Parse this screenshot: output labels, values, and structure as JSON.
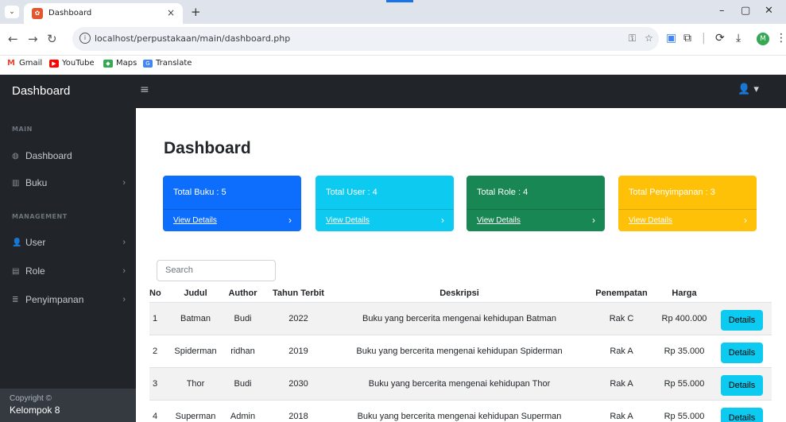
{
  "browser": {
    "tab_title": "Dashboard",
    "tab_close": "×",
    "new_tab": "+",
    "url": "localhost/perpustakaan/main/dashboard.php",
    "bookmarks": [
      "Gmail",
      "YouTube",
      "Maps",
      "Translate"
    ],
    "profile_initial": "M",
    "window_controls": [
      "–",
      "▢",
      "✕"
    ]
  },
  "app": {
    "brand": "Dashboard",
    "hamburger": "≡",
    "user_menu": "👤 ▾"
  },
  "sidebar": {
    "sections": [
      {
        "heading": "MAIN",
        "items": [
          {
            "label": "Dashboard",
            "icon": "dashboard-icon",
            "glyph": "◍",
            "chevron": ""
          },
          {
            "label": "Buku",
            "icon": "columns-icon",
            "glyph": "▥",
            "chevron": "›"
          }
        ]
      },
      {
        "heading": "MANAGEMENT",
        "items": [
          {
            "label": "User",
            "icon": "user-icon",
            "glyph": "👤",
            "chevron": "›"
          },
          {
            "label": "Role",
            "icon": "id-card-icon",
            "glyph": "▤",
            "chevron": "›"
          },
          {
            "label": "Penyimpanan",
            "icon": "archive-icon",
            "glyph": "≣",
            "chevron": "›"
          }
        ]
      }
    ],
    "footer_line1": "Copyright ©",
    "footer_line2": "Kelompok 8"
  },
  "main": {
    "page_title": "Dashboard",
    "cards": [
      {
        "label": "Total Buku : 5",
        "link": "View Details",
        "color": "#0d6efd"
      },
      {
        "label": "Total User : 4",
        "link": "View Details",
        "color": "#0dcaf0"
      },
      {
        "label": "Total Role : 4",
        "link": "View Details",
        "color": "#198754"
      },
      {
        "label": "Total Penyimpanan : 3",
        "link": "View Details",
        "color": "#ffc107"
      }
    ],
    "card_chevron": "›",
    "search_placeholder": "Search",
    "table": {
      "headers": [
        "No",
        "Judul",
        "Author",
        "Tahun Terbit",
        "Deskripsi",
        "Penempatan",
        "Harga",
        ""
      ],
      "rows": [
        [
          "1",
          "Batman",
          "Budi",
          "2022",
          "Buku yang bercerita mengenai kehidupan Batman",
          "Rak C",
          "Rp 400.000"
        ],
        [
          "2",
          "Spiderman",
          "ridhan",
          "2019",
          "Buku yang bercerita mengenai kehidupan Spiderman",
          "Rak A",
          "Rp 35.000"
        ],
        [
          "3",
          "Thor",
          "Budi",
          "2030",
          "Buku yang bercerita mengenai kehidupan Thor",
          "Rak A",
          "Rp 55.000"
        ],
        [
          "4",
          "Superman",
          "Admin",
          "2018",
          "Buku yang bercerita mengenai kehidupan Superman",
          "Rak A",
          "Rp 55.000"
        ]
      ],
      "action_label": "Details"
    }
  }
}
